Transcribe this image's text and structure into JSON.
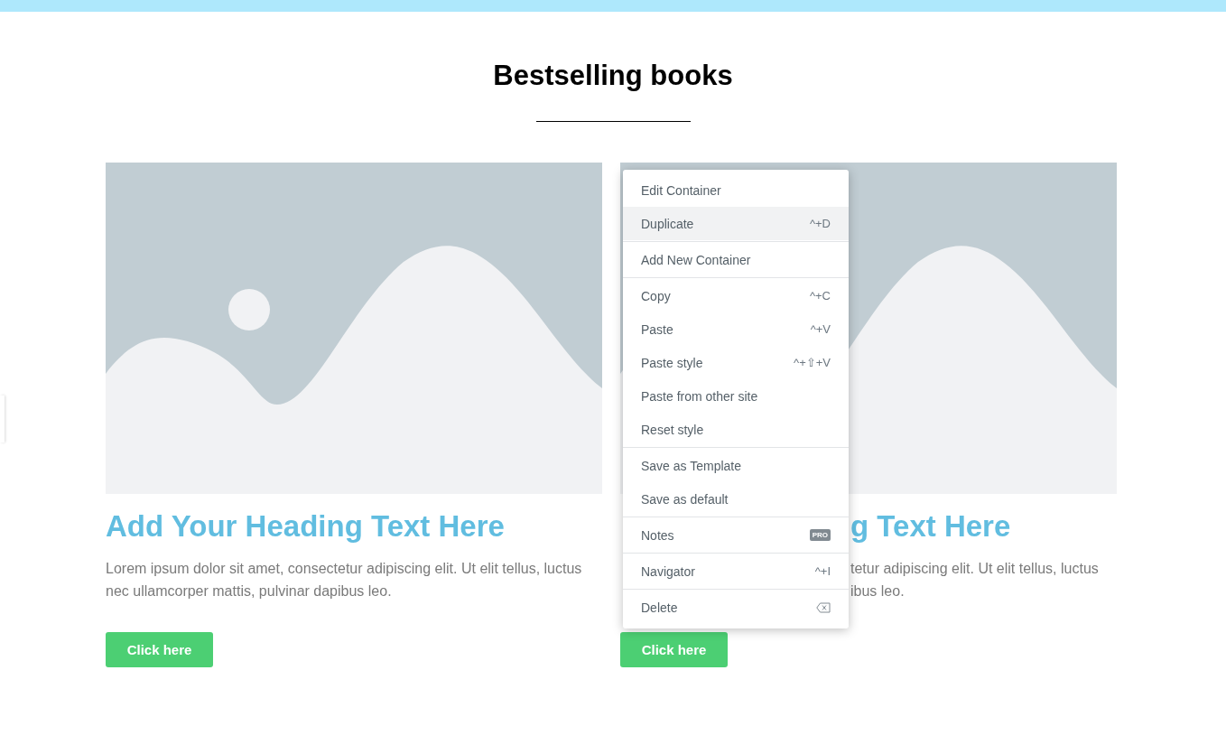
{
  "section": {
    "title": "Bestselling books"
  },
  "cards": [
    {
      "covered": false,
      "heading": "Add Your Heading Text Here",
      "text_lines": [
        "Lorem ipsum dolor sit amet, consectetur adipiscing elit. Ut elit tellus, luctus",
        "nec ullamcorper mattis, pulvinar dapibus leo."
      ],
      "button": "Click here"
    },
    {
      "covered": true,
      "heading": "g Text Here",
      "text_lines": [
        "tetur adipiscing elit. Ut elit tellus, luctus",
        "ibus leo."
      ],
      "button": "Click here"
    }
  ],
  "context_menu": {
    "groups": [
      {
        "items": [
          {
            "label": "Edit Container",
            "kind": "plain",
            "selected": false
          },
          {
            "label": "Duplicate",
            "kind": "shortcut",
            "shortcut": "^+D",
            "selected": true
          }
        ]
      },
      {
        "items": [
          {
            "label": "Add New Container",
            "kind": "plain",
            "selected": false
          }
        ]
      },
      {
        "items": [
          {
            "label": "Copy",
            "kind": "shortcut",
            "shortcut": "^+C",
            "selected": false
          },
          {
            "label": "Paste",
            "kind": "shortcut",
            "shortcut": "^+V",
            "selected": false
          },
          {
            "label": "Paste style",
            "kind": "shortcut",
            "shortcut": "^+⇧+V",
            "selected": false
          },
          {
            "label": "Paste from other site",
            "kind": "plain",
            "selected": false
          },
          {
            "label": "Reset style",
            "kind": "plain",
            "selected": false
          }
        ]
      },
      {
        "items": [
          {
            "label": "Save as Template",
            "kind": "plain",
            "selected": false
          },
          {
            "label": "Save as default",
            "kind": "plain",
            "selected": false
          }
        ]
      },
      {
        "items": [
          {
            "label": "Notes",
            "kind": "badge",
            "badge": "PRO",
            "selected": false
          }
        ]
      },
      {
        "items": [
          {
            "label": "Navigator",
            "kind": "shortcut",
            "shortcut": "^+I",
            "selected": false
          }
        ]
      },
      {
        "items": [
          {
            "label": "Delete",
            "kind": "icon",
            "selected": false
          }
        ]
      }
    ]
  }
}
